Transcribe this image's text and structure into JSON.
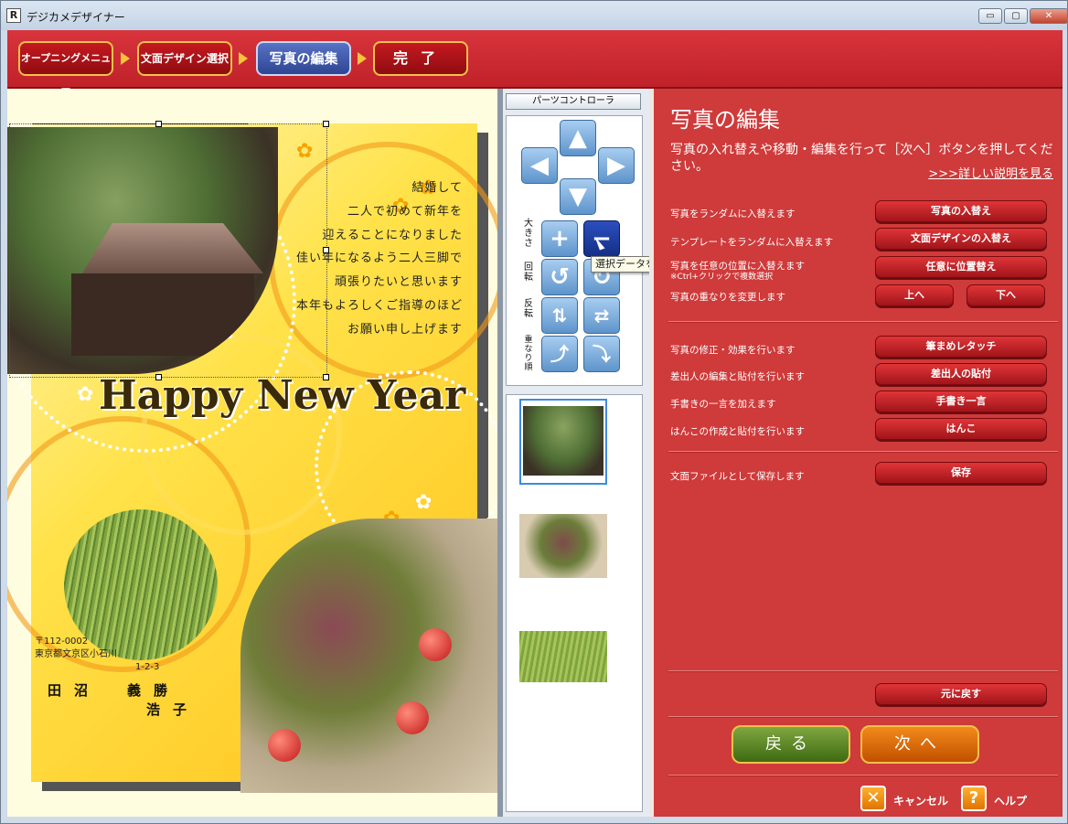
{
  "window": {
    "title": "デジカメデザイナー",
    "minimize_label": "▭",
    "maximize_label": "▢",
    "close_label": "✕"
  },
  "steps": {
    "opening": "オープニングメニュー",
    "design_select": "文面デザイン選択",
    "photo_edit": "写真の編集",
    "done": "完了"
  },
  "card": {
    "message_lines": [
      "結婚して",
      "二人で初めて新年を",
      "迎えることになりました",
      "佳い年になるよう二人三脚で",
      "頑張りたいと思います",
      "本年もよろしくご指導のほど",
      "お願い申し上げます"
    ],
    "headline": "Happy New Year",
    "postal": "〒112-0002",
    "address": "東京都文京区小石川",
    "address_num": "1-2-3",
    "name_line1": "田沼　義勝",
    "name_line2": "浩子"
  },
  "parts_controller": {
    "title": "パーツコントローラ",
    "labels": {
      "size": "大きさ",
      "rotate": "回転",
      "flip": "反転",
      "order": "重なり順"
    },
    "tooltip": "選択データを小さくします"
  },
  "panel": {
    "title": "写真の編集",
    "description": "写真の入れ替えや移動・編集を行って［次へ］ボタンを押してください。",
    "link": ">>>詳しい説明を見る",
    "rows": {
      "random_photo": "写真をランダムに入替えます",
      "random_template": "テンプレートをランダムに入替えます",
      "arbitrary_pos": "写真を任意の位置に入替えます",
      "ctrl_note": "※Ctrl+クリックで複数選択",
      "order": "写真の重なりを変更します",
      "correction": "写真の修正・効果を行います",
      "sender": "差出人の編集と貼付を行います",
      "handwriting": "手書きの一言を加えます",
      "hanko": "はんこの作成と貼付を行います",
      "save": "文面ファイルとして保存します"
    },
    "buttons": {
      "photo_swap": "写真の入替え",
      "design_swap": "文面デザインの入替え",
      "position_swap": "任意に位置替え",
      "up": "上へ",
      "down": "下へ",
      "retouch": "筆まめレタッチ",
      "sender_paste": "差出人の貼付",
      "handwriting": "手書き一言",
      "hanko": "はんこ",
      "save": "保存",
      "undo": "元に戻す",
      "back": "戻る",
      "next": "次へ",
      "cancel": "キャンセル",
      "help": "ヘルプ"
    }
  }
}
